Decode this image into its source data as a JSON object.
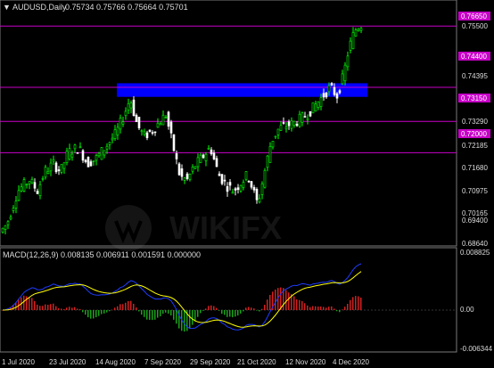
{
  "symbol_header": {
    "arrow_glyph": "▼",
    "symbol": "AUDUSD,Daily",
    "ohlc": "0.75734 0.75766 0.75664 0.75701"
  },
  "macd_header": "MACD(12,26,9) 0.008135 0.006911 0.001591 0.000000",
  "price_axis": {
    "ticks": [
      "0.75500",
      "0.74395",
      "0.73290",
      "0.72185",
      "0.71680",
      "0.70975",
      "0.70165",
      "0.69400",
      "0.68640"
    ],
    "marked_levels": [
      "0.76650",
      "0.74400",
      "0.73150",
      "0.72000"
    ]
  },
  "macd_axis": {
    "ticks": [
      "0.008825",
      "0.00",
      "-0.006344"
    ]
  },
  "time_axis": [
    "1 Jul 2020",
    "23 Jul 2020",
    "14 Aug 2020",
    "7 Sep 2020",
    "29 Sep 2020",
    "21 Oct 2020",
    "12 Nov 2020",
    "4 Dec 2020"
  ],
  "watermark": "WIKIFX",
  "chart_data": {
    "type": "candlestick",
    "price_range": [
      0.6864,
      0.7715
    ],
    "level_lines": [
      0.7665,
      0.744,
      0.7315,
      0.72
    ],
    "resistance_zone": {
      "from": 0.7405,
      "to": 0.7455
    },
    "price_path": [
      [
        0,
        0.69
      ],
      [
        10,
        0.694
      ],
      [
        22,
        0.706
      ],
      [
        35,
        0.71
      ],
      [
        44,
        0.706
      ],
      [
        52,
        0.713
      ],
      [
        62,
        0.716
      ],
      [
        70,
        0.713
      ],
      [
        78,
        0.72
      ],
      [
        90,
        0.722
      ],
      [
        100,
        0.716
      ],
      [
        110,
        0.718
      ],
      [
        120,
        0.722
      ],
      [
        132,
        0.727
      ],
      [
        140,
        0.733
      ],
      [
        148,
        0.74
      ],
      [
        156,
        0.73
      ],
      [
        164,
        0.726
      ],
      [
        172,
        0.728
      ],
      [
        180,
        0.731
      ],
      [
        188,
        0.734
      ],
      [
        195,
        0.724
      ],
      [
        204,
        0.711
      ],
      [
        212,
        0.71
      ],
      [
        220,
        0.715
      ],
      [
        228,
        0.718
      ],
      [
        238,
        0.722
      ],
      [
        247,
        0.712
      ],
      [
        256,
        0.708
      ],
      [
        264,
        0.706
      ],
      [
        272,
        0.709
      ],
      [
        280,
        0.712
      ],
      [
        286,
        0.706
      ],
      [
        291,
        0.701
      ],
      [
        298,
        0.712
      ],
      [
        306,
        0.724
      ],
      [
        315,
        0.729
      ],
      [
        324,
        0.73
      ],
      [
        332,
        0.731
      ],
      [
        342,
        0.733
      ],
      [
        352,
        0.736
      ],
      [
        362,
        0.74
      ],
      [
        372,
        0.744
      ],
      [
        380,
        0.741
      ],
      [
        387,
        0.748
      ],
      [
        393,
        0.758
      ],
      [
        400,
        0.765
      ],
      [
        406,
        0.767
      ]
    ],
    "macd": {
      "range": [
        -0.006344,
        0.008825
      ],
      "histogram_sign_pattern": "green-bars-below-zero-then-red-bars-above-zero",
      "line_colors": {
        "main": "#1e3cff",
        "signal": "#ffff00",
        "hist_up": "#d22020",
        "hist_down": "#1aa01a"
      }
    }
  },
  "colors": {
    "background": "#000000",
    "candle_bull": "#00ff00",
    "candle_bear": "#ffffff",
    "zone": "#0000ff",
    "level_line": "#c800c8",
    "axis_text": "#dcdcdc",
    "level_label_bg": "#c800c8"
  }
}
